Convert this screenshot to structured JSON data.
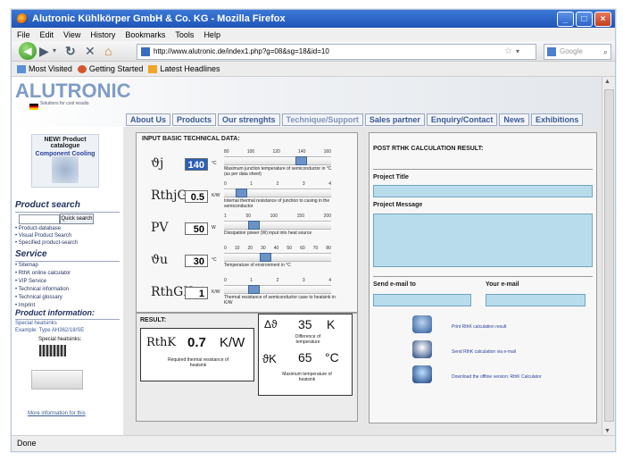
{
  "window": {
    "title": "Alutronic Kühlkörper GmbH & Co. KG - Mozilla Firefox"
  },
  "menu": [
    "File",
    "Edit",
    "View",
    "History",
    "Bookmarks",
    "Tools",
    "Help"
  ],
  "address": {
    "url": "http://www.alutronic.de/index1.php?g=08&sg=18&id=10",
    "search_placeholder": "Google"
  },
  "bookmarks": [
    "Most Visited",
    "Getting Started",
    "Latest Headlines"
  ],
  "status": "Done",
  "site": {
    "logo": "ALUTRONIC",
    "logo_sub": "Solutions for cool results",
    "tabs": [
      "About Us",
      "Products",
      "Our strenghts",
      "Technique/Support",
      "Sales partner",
      "Enquiry/Contact",
      "News",
      "Exhibitions"
    ],
    "new_box": {
      "line1": "NEW! Product catalogue",
      "line2": "Component Cooling"
    },
    "product_search": {
      "heading": "Product search",
      "button": "Quick search",
      "links": [
        "Product-database",
        "Visual Product Search",
        "Specified product-search"
      ]
    },
    "service": {
      "heading": "Service",
      "links": [
        "Sitemap",
        "RthK online calculator",
        "VIP Service",
        "Technical information",
        "Technical glossary",
        "Imprint"
      ]
    },
    "product_info": {
      "heading": "Product information:",
      "line1": "Special heatsinks",
      "line2": "Example: Type AH362/18/SE",
      "caption": "Special heatsinks:",
      "more": "More information for this"
    }
  },
  "calc": {
    "input_title": "INPUT BASIC TECHNICAL DATA:",
    "rows": [
      {
        "symbol": "ϑj",
        "value": "140",
        "unit": "°C",
        "scale": [
          "80",
          "100",
          "120",
          "140",
          "160"
        ],
        "level": 0.73,
        "desc": "Maximum junction temperature of semiconductor in °C (as per data sheet)"
      },
      {
        "symbol": "RthjG",
        "value": "0.5",
        "unit": "K/W",
        "scale": [
          "0",
          "1",
          "2",
          "3",
          "4"
        ],
        "level": 0.12,
        "desc": "Internal thermal resistance of junction to casing in the semiconductor"
      },
      {
        "symbol": "PV",
        "value": "50",
        "unit": "W",
        "scale": [
          "1",
          "50",
          "100",
          "150",
          "200"
        ],
        "level": 0.25,
        "desc": "Dissipation power (W) input into heat source"
      },
      {
        "symbol": "ϑu",
        "value": "30",
        "unit": "°C",
        "scale": [
          "0",
          "10",
          "20",
          "30",
          "40",
          "50",
          "60",
          "70",
          "80"
        ],
        "level": 0.37,
        "desc": "Temperature of environment in °C"
      },
      {
        "symbol": "RthGK",
        "value": "1",
        "unit": "K/W",
        "scale": [
          "0",
          "1",
          "2",
          "3",
          "4"
        ],
        "level": 0.25,
        "desc": "Thermal resistance of semiconductor case to heatsink in K/W"
      }
    ],
    "result_title": "RESULT:",
    "result_rthk": {
      "label": "RthK",
      "value": "0.7",
      "unit": "K/W",
      "desc": "Required thermal resistance of heatsink"
    },
    "result_delta": {
      "label": "Δϑ",
      "value": "35",
      "unit": "K",
      "desc": "Difference of temperature"
    },
    "result_tk": {
      "label": "ϑK",
      "value": "65",
      "unit": "°C",
      "desc": "Maximum temperature of heatsink"
    }
  },
  "post": {
    "title": "POST RTHK CALCULATION RESULT:",
    "project_title": "Project Title",
    "project_message": "Project Message",
    "send_to": "Send e-mail to",
    "your_email": "Your e-mail",
    "actions": [
      "Print RthK calculation result",
      "Send RthK calculation via e-mail",
      "Download the offline version: RthK Calculator"
    ]
  }
}
